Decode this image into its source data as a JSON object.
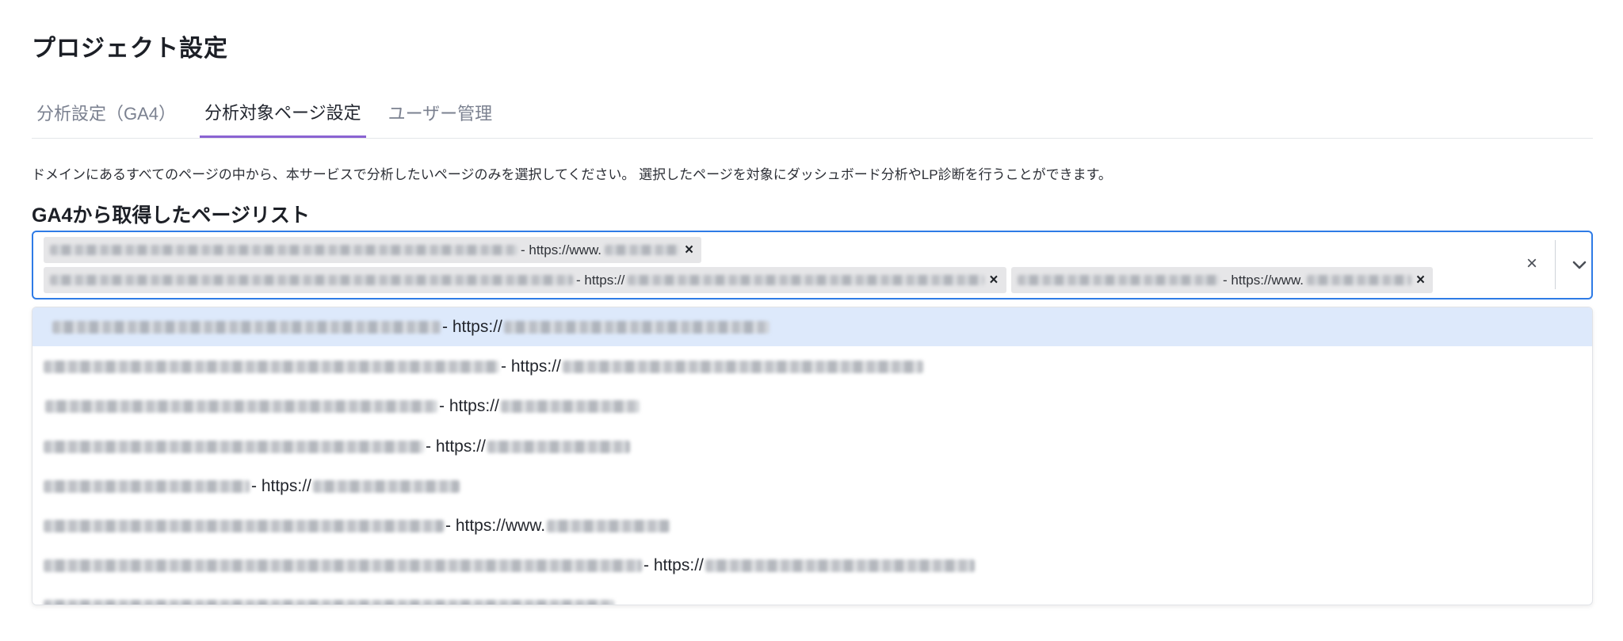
{
  "page": {
    "title": "プロジェクト設定",
    "description": "ドメインにあるすべてのページの中から、本サービスで分析したいページのみを選択してください。 選択したページを対象にダッシュボード分析やLP診断を行うことができます。",
    "list_heading": "GA4から取得したページリスト"
  },
  "tabs": [
    {
      "label": "分析設定（GA4）",
      "active": false
    },
    {
      "label": "分析対象ページ設定",
      "active": true
    },
    {
      "label": "ユーザー管理",
      "active": false
    }
  ],
  "selected_chips": [
    {
      "url_prefix": "- https://www.",
      "remove_label": "×"
    },
    {
      "url_prefix": "- https://",
      "remove_label": "×"
    },
    {
      "url_prefix": "- https://www.",
      "remove_label": "×"
    }
  ],
  "controls": {
    "clear_label": "×",
    "accent_color": "#2e7be6",
    "tab_indicator_color": "#8a63d2",
    "highlight_color": "#dde9fb",
    "icons": [
      "close-icon",
      "chevron-down-icon"
    ]
  },
  "options": [
    {
      "url_prefix": "- https://",
      "highlighted": true
    },
    {
      "url_prefix": "- https://",
      "highlighted": false
    },
    {
      "url_prefix": "- https://",
      "highlighted": false
    },
    {
      "url_prefix": "- https://",
      "highlighted": false
    },
    {
      "url_prefix": "- https://",
      "highlighted": false
    },
    {
      "url_prefix": "- https://www.",
      "highlighted": false
    },
    {
      "url_prefix": "- https://",
      "highlighted": false
    }
  ]
}
